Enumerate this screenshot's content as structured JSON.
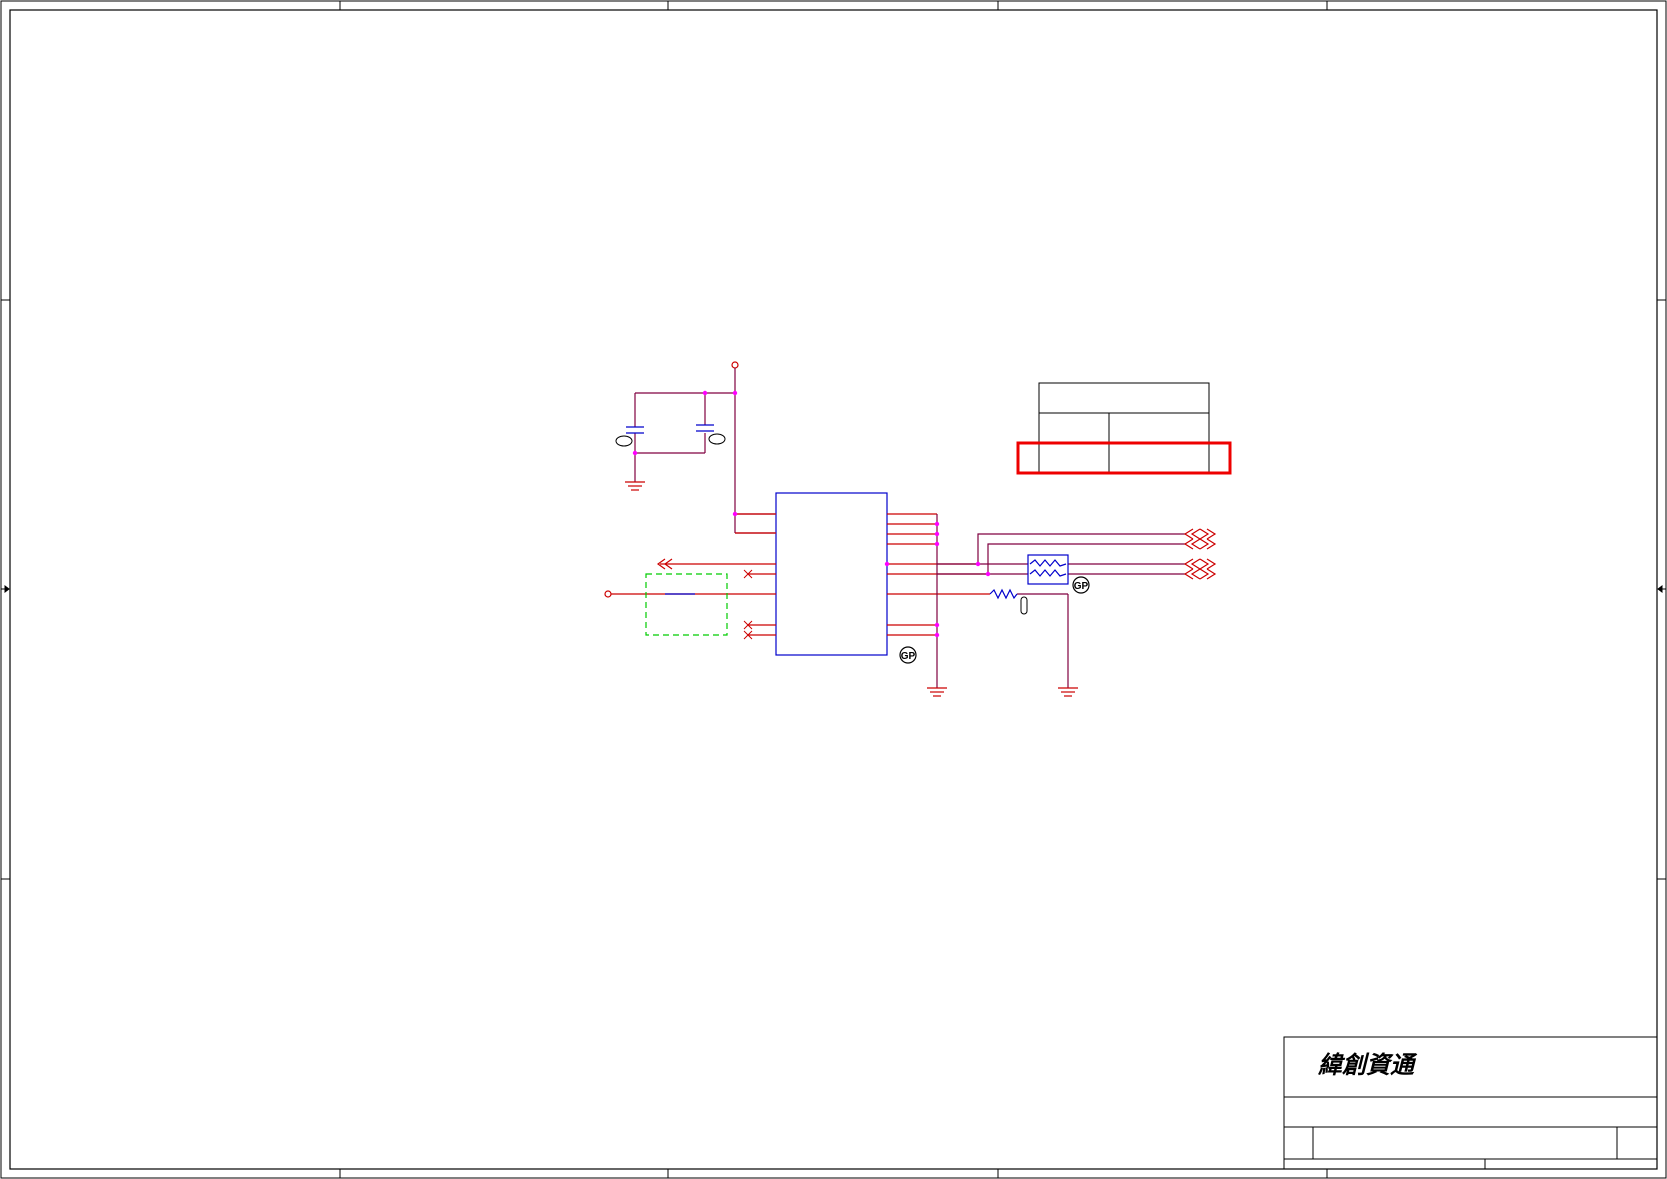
{
  "drawing": {
    "type": "electrical schematic",
    "background_color": "#ffffff"
  },
  "title_block": {
    "company_name": "緯創資通"
  },
  "symbols": {
    "gp_badge_label": "GP"
  },
  "colors": {
    "frame": "#000000",
    "wire": "#800040",
    "pin": "#cc0000",
    "component": "#0000cc",
    "junction": "#ff00ff",
    "highlight": "#ee0000",
    "dashed_box": "#00cc00"
  }
}
